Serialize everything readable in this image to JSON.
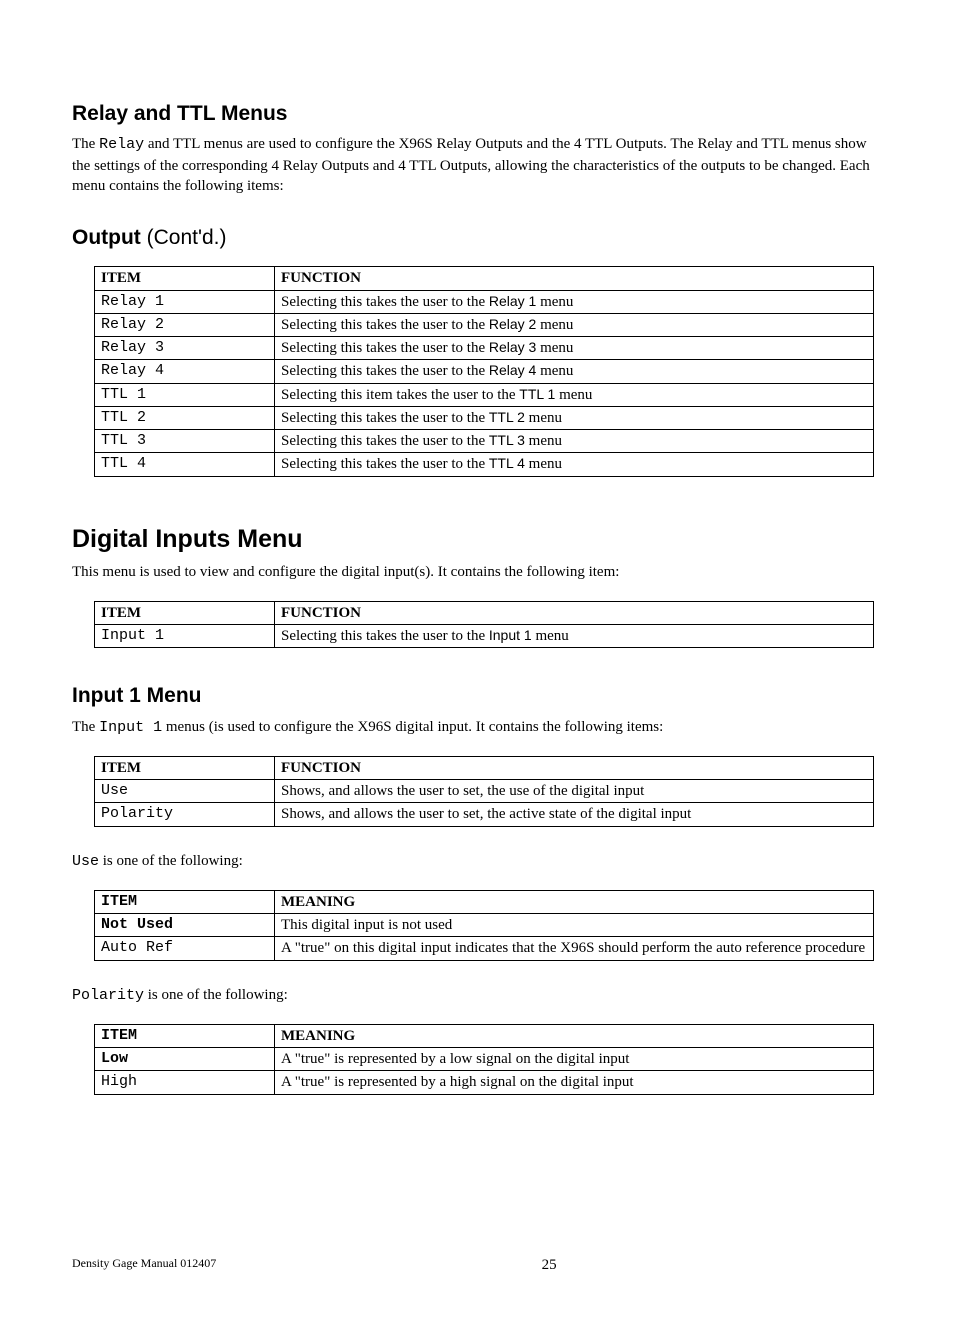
{
  "sections": {
    "relay_ttl": {
      "heading": "Relay and TTL Menus",
      "para_pre": "The ",
      "para_relay": "Relay",
      "para_post": " and TTL menus are used to configure the X96S Relay Outputs and the 4 TTL Outputs. The Relay and TTL menus show the settings of the corresponding 4 Relay Outputs and 4 TTL Outputs, allowing the characteristics of the outputs to be changed.  Each menu contains the following items:"
    },
    "output_cont": {
      "bold": "Output ",
      "rest": "(Cont'd.)"
    },
    "output_table": {
      "h_item": "ITEM",
      "h_func": "FUNCTION",
      "rows": [
        {
          "item": "Relay 1",
          "pre": "Selecting this takes the user to the ",
          "link": "Relay 1",
          "post": " menu"
        },
        {
          "item": "Relay 2",
          "pre": "Selecting this takes the user to the ",
          "link": "Relay 2",
          "post": " menu"
        },
        {
          "item": "Relay 3",
          "pre": "Selecting this takes the user to the ",
          "link": "Relay 3",
          "post": " menu"
        },
        {
          "item": "Relay 4",
          "pre": "Selecting this takes the user to the ",
          "link": "Relay 4",
          "post": " menu"
        },
        {
          "item": "TTL 1",
          "pre": "Selecting this item takes the user to the ",
          "link": "TTL 1",
          "post": " menu"
        },
        {
          "item": "TTL 2",
          "pre": "Selecting this takes the user to the ",
          "link": "TTL 2",
          "post": " menu"
        },
        {
          "item": "TTL 3",
          "pre": "Selecting this takes the user to the ",
          "link": "TTL 3",
          "post": " menu"
        },
        {
          "item": "TTL 4",
          "pre": "Selecting this takes the user to the ",
          "link": "TTL 4",
          "post": " menu"
        }
      ]
    },
    "digital_inputs": {
      "heading": "Digital Inputs Menu",
      "para": "This menu is used to view and configure the digital input(s).  It contains the following item:"
    },
    "di_table": {
      "h_item": "ITEM",
      "h_func": "FUNCTION",
      "rows": [
        {
          "item": "Input 1",
          "pre": "Selecting this takes the user to the ",
          "link": "Input 1",
          "post": " menu"
        }
      ]
    },
    "input1": {
      "heading": "Input 1 Menu",
      "para_pre": "The ",
      "para_mono": "Input 1",
      "para_post": " menus (is used to configure the X96S digital input.  It contains the following items:"
    },
    "in1_table": {
      "h_item": "ITEM",
      "h_func": "FUNCTION",
      "rows": [
        {
          "item": "Use",
          "func": "Shows, and allows the user to set,  the use of the digital input"
        },
        {
          "item": "Polarity",
          "func": "Shows, and allows the user to set,  the active state of the digital input"
        }
      ]
    },
    "use_intro": {
      "mono": "Use",
      "rest": " is one of the following:"
    },
    "use_table": {
      "h_item": "ITEM",
      "h_mean": "MEANING",
      "rows": [
        {
          "item": "Not Used",
          "bold": true,
          "mean": "This digital input is not used"
        },
        {
          "item": "Auto Ref",
          "bold": false,
          "mean": "A \"true\" on this digital input indicates that the X96S should perform the auto reference procedure"
        }
      ]
    },
    "pol_intro": {
      "mono": "Polarity",
      "rest": " is one of the following:"
    },
    "pol_table": {
      "h_item": "ITEM",
      "h_mean": "MEANING",
      "rows": [
        {
          "item": "Low",
          "bold": true,
          "mean": "A \"true\" is represented by a low signal on the digital input"
        },
        {
          "item": "High",
          "bold": false,
          "mean": "A \"true\" is represented by a high signal on the digital input"
        }
      ]
    }
  },
  "footer": {
    "left": "Density Gage Manual 012407",
    "page": "25"
  }
}
